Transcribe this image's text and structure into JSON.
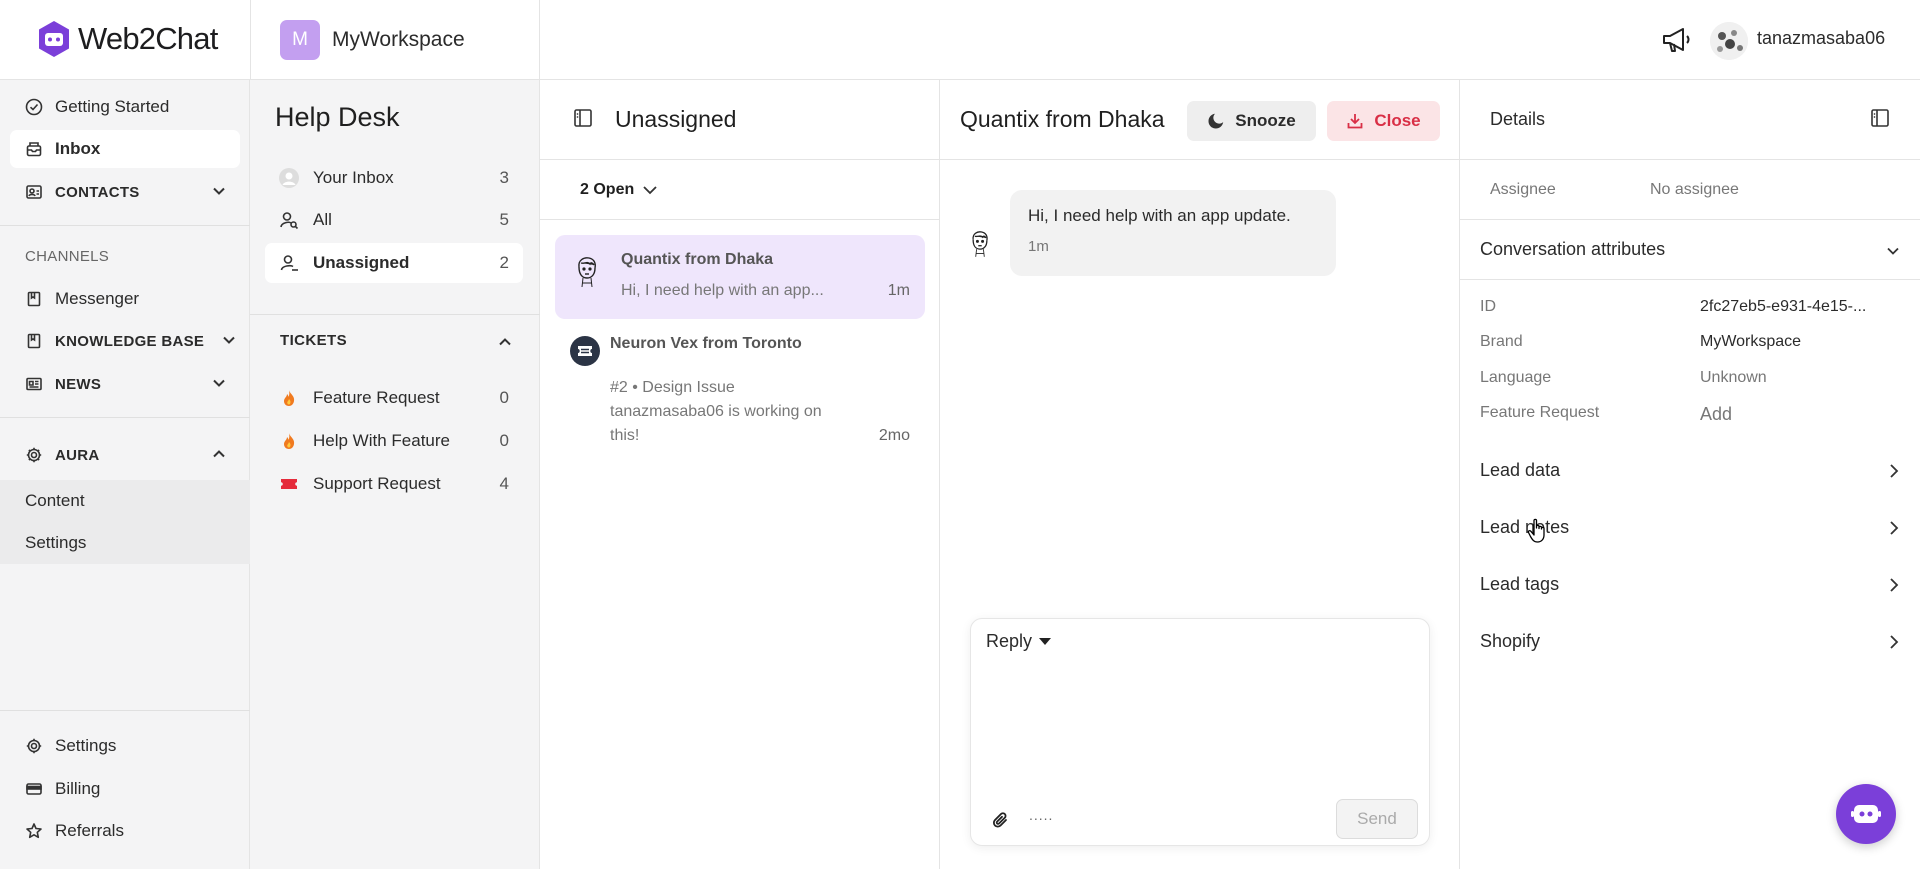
{
  "brand": {
    "name": "Web2Chat",
    "accent": "#7b3fd9"
  },
  "workspace": {
    "initial": "M",
    "name": "MyWorkspace",
    "badge_color": "#c39ff0"
  },
  "topbar": {
    "username": "tanazmasaba06",
    "announce_icon": "megaphone-icon"
  },
  "nav": {
    "getting_started": "Getting Started",
    "inbox": "Inbox",
    "contacts": "CONTACTS",
    "channels_label": "CHANNELS",
    "messenger": "Messenger",
    "knowledge_base": "KNOWLEDGE BASE",
    "news": "NEWS",
    "aura": "AURA",
    "aura_content": "Content",
    "aura_settings": "Settings",
    "settings": "Settings",
    "billing": "Billing",
    "referrals": "Referrals"
  },
  "helpdesk": {
    "title": "Help Desk",
    "your_inbox": {
      "label": "Your Inbox",
      "count": "3"
    },
    "all": {
      "label": "All",
      "count": "5"
    },
    "unassigned": {
      "label": "Unassigned",
      "count": "2"
    },
    "tickets_label": "TICKETS",
    "tickets": [
      {
        "label": "Feature Request",
        "count": "0",
        "icon": "fire-icon"
      },
      {
        "label": "Help With Feature",
        "count": "0",
        "icon": "fire-icon"
      },
      {
        "label": "Support Request",
        "count": "4",
        "icon": "ticket-icon"
      }
    ]
  },
  "convlist": {
    "title": "Unassigned",
    "filter": "2 Open",
    "items": [
      {
        "name": "Quantix from Dhaka",
        "preview": "Hi, I need help with an app...",
        "time": "1m"
      },
      {
        "name": "Neuron Vex from Toronto",
        "preview_line1": "#2 • Design Issue",
        "preview_line2": "tanazmasaba06 is working on",
        "preview_line3": "this!",
        "time": "2mo"
      }
    ]
  },
  "chat": {
    "title": "Quantix from Dhaka",
    "snooze": "Snooze",
    "close": "Close",
    "message": {
      "text": "Hi, I need help with an app update.",
      "time": "1m"
    },
    "reply_mode": "Reply",
    "emoji_hint": ".....",
    "send": "Send",
    "input_placeholder": ""
  },
  "details": {
    "title": "Details",
    "assignee_label": "Assignee",
    "assignee_value": "No assignee",
    "attrs_title": "Conversation attributes",
    "attrs": {
      "id_label": "ID",
      "id_value": "2fc27eb5-e931-4e15-...",
      "brand_label": "Brand",
      "brand_value": "MyWorkspace",
      "language_label": "Language",
      "language_value": "Unknown",
      "feature_label": "Feature Request",
      "feature_value": "Add"
    },
    "sections": {
      "lead_data": "Lead data",
      "lead_notes": "Lead notes",
      "lead_tags": "Lead tags",
      "shopify": "Shopify"
    }
  }
}
